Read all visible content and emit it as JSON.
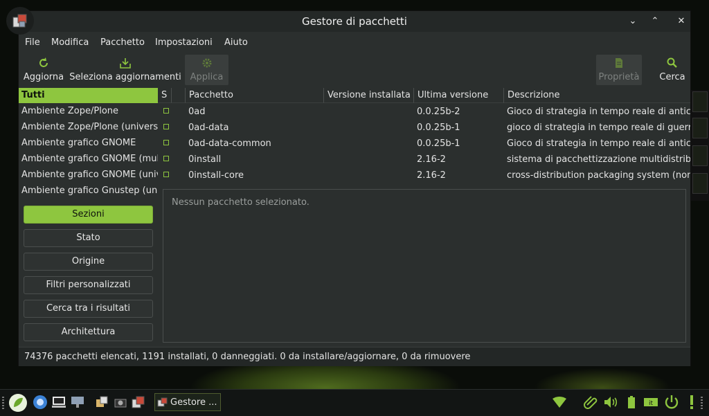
{
  "window": {
    "title": "Gestore di pacchetti",
    "controls": {
      "minimize": "⌄",
      "maximize": "⌃",
      "close": "✕"
    }
  },
  "menu": [
    "File",
    "Modifica",
    "Pacchetto",
    "Impostazioni",
    "Aiuto"
  ],
  "toolbar": {
    "reload_label": "Aggiorna",
    "mark_upgrades_label": "Seleziona aggiornamenti",
    "apply_label": "Applica",
    "properties_label": "Proprietà",
    "search_label": "Cerca"
  },
  "filters": {
    "header": "Tutti",
    "items": [
      "Ambiente Zope/Plone",
      "Ambiente Zope/Plone (universe)",
      "Ambiente grafico GNOME",
      "Ambiente grafico GNOME (multiverse)",
      "Ambiente grafico GNOME (universe)",
      "Ambiente grafico Gnustep (universe)"
    ]
  },
  "columns": {
    "status": "S",
    "package": "Pacchetto",
    "installed_version": "Versione installata",
    "latest_version": "Ultima versione",
    "description": "Descrizione"
  },
  "packages": [
    {
      "name": "0ad",
      "installed": "",
      "latest": "0.0.25b-2",
      "description": "Gioco di strategia in tempo reale di antica guerra"
    },
    {
      "name": "0ad-data",
      "installed": "",
      "latest": "0.0.25b-1",
      "description": "gioco di strategia in tempo reale di guerra antica"
    },
    {
      "name": "0ad-data-common",
      "installed": "",
      "latest": "0.0.25b-1",
      "description": "Gioco di strategia in tempo reale di antica guerra"
    },
    {
      "name": "0install",
      "installed": "",
      "latest": "2.16-2",
      "description": "sistema di pacchettizzazione multidistribuzione"
    },
    {
      "name": "0install-core",
      "installed": "",
      "latest": "2.16-2",
      "description": "cross-distribution packaging system (non-GUI parts)"
    }
  ],
  "sidebar_buttons": {
    "sections": "Sezioni",
    "status": "Stato",
    "origin": "Origine",
    "custom_filters": "Filtri personalizzati",
    "search_results": "Cerca tra i risultati",
    "architecture": "Architettura"
  },
  "details": {
    "empty_text": "Nessun pacchetto selezionato."
  },
  "statusbar": {
    "text": "74376 pacchetti elencati, 1191 installati, 0 danneggiati. 0 da installare/aggiornare, 0 da rimuovere"
  },
  "taskbar": {
    "task_label": "Gestore ..."
  },
  "colors": {
    "accent": "#8ec63f",
    "window_bg": "#2b2f2e",
    "titlebar_bg": "#242827"
  }
}
